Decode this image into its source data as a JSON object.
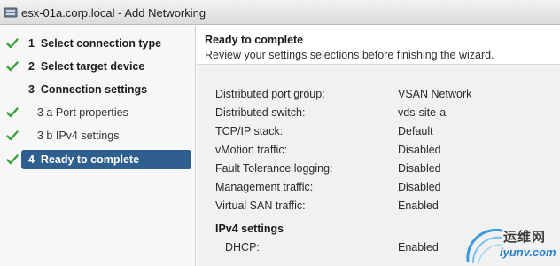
{
  "window": {
    "title": "esx-01a.corp.local - Add Networking"
  },
  "sidebar": {
    "steps": [
      {
        "number": "1",
        "label": "Select connection type",
        "completed": true,
        "active": false
      },
      {
        "number": "2",
        "label": "Select target device",
        "completed": true,
        "active": false
      },
      {
        "number": "3",
        "label": "Connection settings",
        "completed": false,
        "active": false
      },
      {
        "number": "3 a",
        "label": "Port properties",
        "completed": true,
        "active": false
      },
      {
        "number": "3 b",
        "label": "IPv4 settings",
        "completed": true,
        "active": false
      },
      {
        "number": "4",
        "label": "Ready to complete",
        "completed": true,
        "active": true
      }
    ]
  },
  "content": {
    "title": "Ready to complete",
    "subtitle": "Review your settings selections before finishing the wizard.",
    "summary": [
      {
        "key": "Distributed port group:",
        "value": "VSAN Network"
      },
      {
        "key": "Distributed switch:",
        "value": "vds-site-a"
      },
      {
        "key": "TCP/IP stack:",
        "value": "Default"
      },
      {
        "key": "vMotion traffic:",
        "value": "Disabled"
      },
      {
        "key": "Fault Tolerance logging:",
        "value": "Disabled"
      },
      {
        "key": "Management traffic:",
        "value": "Disabled"
      },
      {
        "key": "Virtual SAN traffic:",
        "value": "Enabled"
      }
    ],
    "ipv4": {
      "section_title": "IPv4 settings",
      "rows": [
        {
          "key": "DHCP:",
          "value": "Enabled"
        }
      ]
    }
  },
  "watermark": {
    "cn": "运维网",
    "en": "iyunv.com"
  },
  "colors": {
    "check": "#3aa13a",
    "active_step": "#2f5f8f",
    "summary_bg": "#f1f1f1"
  }
}
